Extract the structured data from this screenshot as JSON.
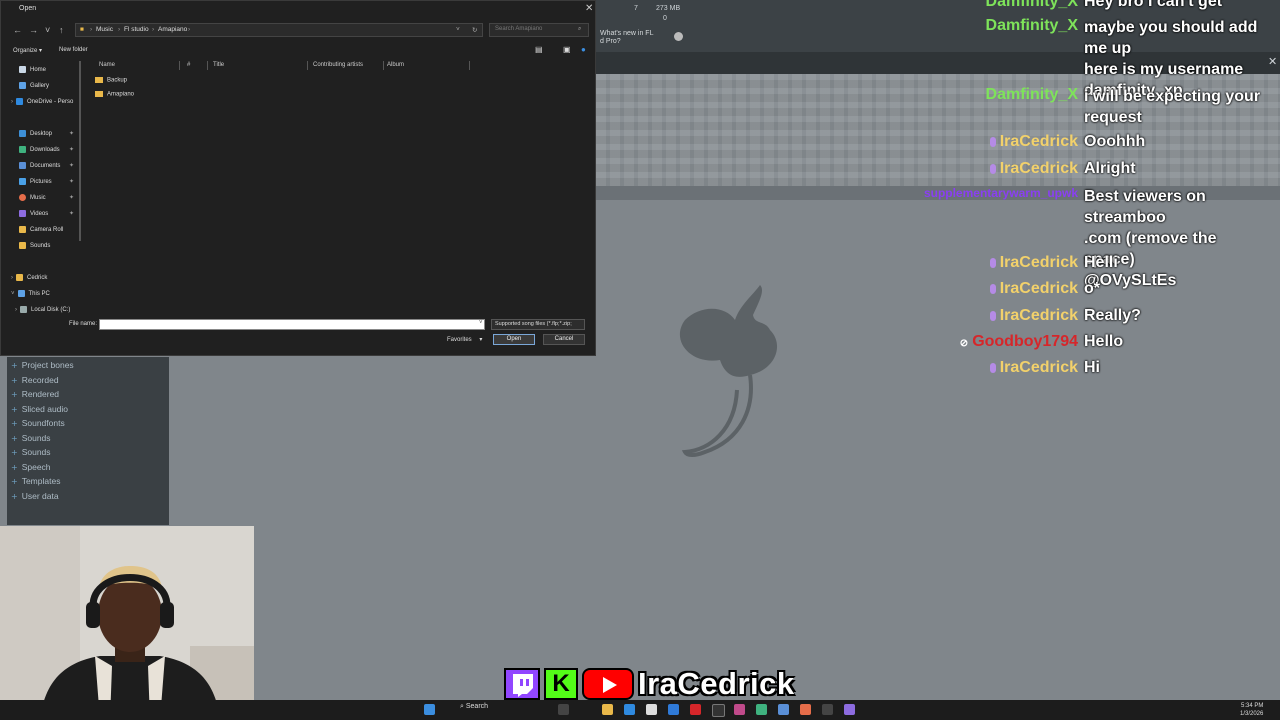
{
  "dialog": {
    "title": "Open",
    "close": "✕",
    "breadcrumb": [
      "Music",
      "Fl studio",
      "Amapiano"
    ],
    "search_placeholder": "Search Amapiano",
    "toolbar": {
      "organize": "Organize ▾",
      "new_folder": "New folder"
    },
    "nav": [
      {
        "label": "Home",
        "color": "#c9d7e6"
      },
      {
        "label": "Gallery",
        "color": "#5ea2e6"
      },
      {
        "label": "OneDrive - Perso",
        "color": "#2f8ae0"
      },
      {
        "label": "Desktop",
        "color": "#3d8fd6"
      },
      {
        "label": "Downloads",
        "color": "#3fb27f"
      },
      {
        "label": "Documents",
        "color": "#5a8fd6"
      },
      {
        "label": "Pictures",
        "color": "#4aa1e8"
      },
      {
        "label": "Music",
        "color": "#e66d4a"
      },
      {
        "label": "Videos",
        "color": "#8d6ce0"
      },
      {
        "label": "Camera Roll",
        "color": "#e9b84a"
      },
      {
        "label": "Sounds",
        "color": "#e9b84a"
      },
      {
        "label": "Cedrick",
        "color": "#e9b84a"
      },
      {
        "label": "This PC",
        "color": "#5ea2e6"
      },
      {
        "label": "Local Disk (C:)",
        "color": "#9aa"
      }
    ],
    "columns": [
      "Name",
      "#",
      "Title",
      "Contributing artists",
      "Album"
    ],
    "files": [
      "Backup",
      "Amapiano"
    ],
    "file_name_label": "File name:",
    "file_name_value": "",
    "file_type": "Supported song files (*.flp;*.zip;",
    "favorites": "Favorites",
    "open_button": "Open",
    "cancel_button": "Cancel"
  },
  "fl": {
    "cpu_value": "7",
    "ram": "273 MB",
    "ram_sub": "0",
    "news": [
      "What's new in FL",
      "d Pro?"
    ],
    "browser": [
      "Project bones",
      "Recorded",
      "Rendered",
      "Sliced audio",
      "Soundfonts",
      "Sounds",
      "Sounds",
      "Speech",
      "Templates",
      "User data"
    ]
  },
  "chat": [
    {
      "user": "Damfinity_X",
      "color": "#7ee35a",
      "lines": [
        "Hey bro I can't get"
      ]
    },
    {
      "user": "Damfinity_X",
      "color": "#7ee35a",
      "lines": [
        "maybe you should add me up",
        "here is my username",
        "damfinity_xp"
      ]
    },
    {
      "user": "Damfinity_X",
      "color": "#7ee35a",
      "lines": [
        "i will be expecting your",
        "request"
      ]
    },
    {
      "user": "IraCedrick",
      "color": "#f2d16b",
      "lines": [
        "Ooohhh"
      ]
    },
    {
      "user": "IraCedrick",
      "color": "#f2d16b",
      "lines": [
        "Alright"
      ]
    },
    {
      "user": "supplementarywarm_upwk",
      "color": "#8a3ff2",
      "lines": [
        "Best viewers on streamboo",
        ".com (remove the space)",
        "@OVySLtEs"
      ]
    },
    {
      "user": "IraCedrick",
      "color": "#f2d16b",
      "lines": [
        "Helli"
      ]
    },
    {
      "user": "IraCedrick",
      "color": "#f2d16b",
      "lines": [
        "o*"
      ]
    },
    {
      "user": "IraCedrick",
      "color": "#f2d16b",
      "lines": [
        "Really?"
      ]
    },
    {
      "user": "Goodboy1794",
      "color": "#d6262a",
      "lines": [
        "Hello"
      ]
    },
    {
      "user": "IraCedrick",
      "color": "#f2d16b",
      "lines": [
        "Hi"
      ]
    }
  ],
  "banner": {
    "name": "IraCedrick",
    "kick_letter": "K"
  },
  "taskbar": {
    "search": "Search",
    "time": "5:34 PM",
    "date": "1/3/2026"
  }
}
